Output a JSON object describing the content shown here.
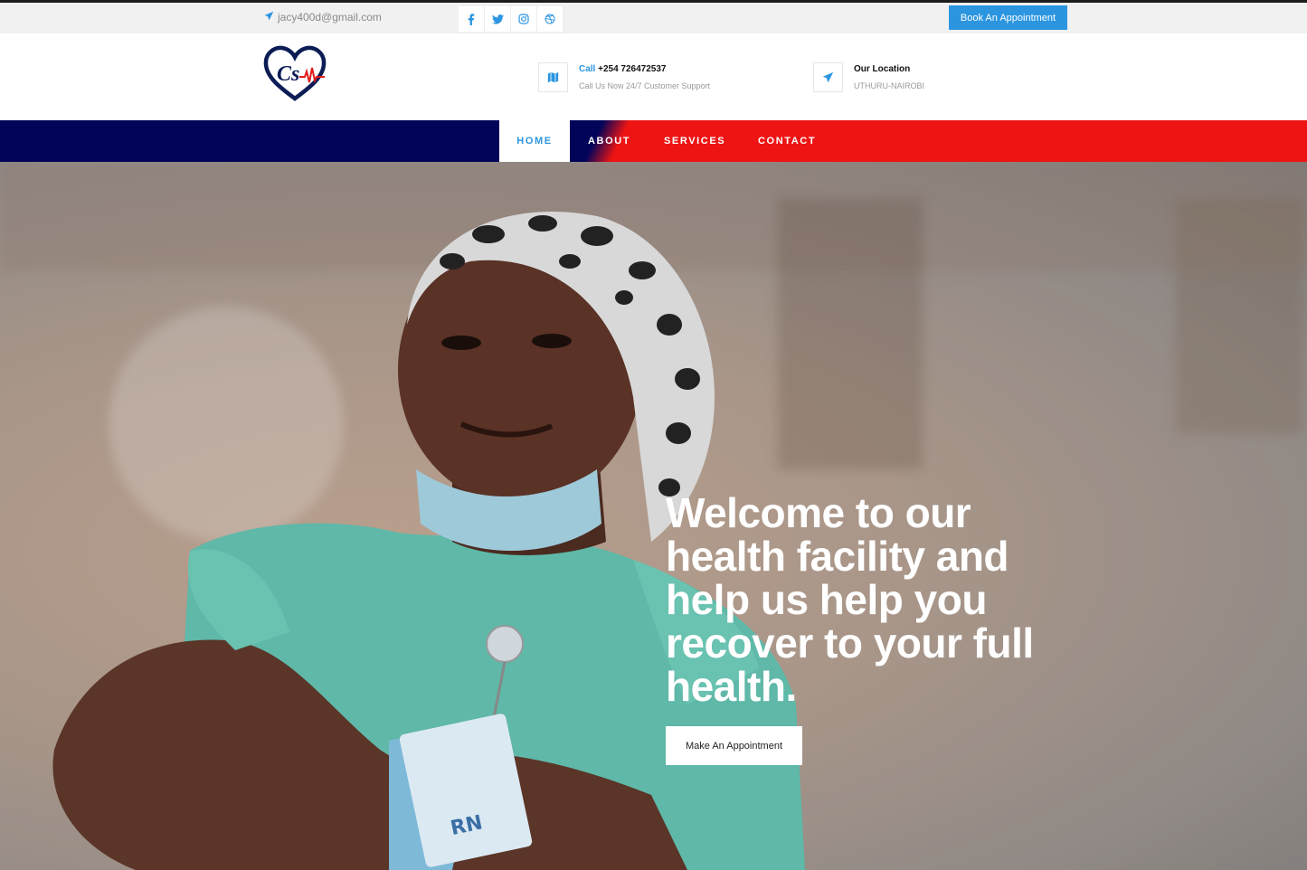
{
  "topbar": {
    "email": "jacy400d@gmail.com",
    "social_icons": [
      "facebook-icon",
      "twitter-icon",
      "instagram-icon",
      "dribbble-icon"
    ],
    "book_label": "Book An Appointment"
  },
  "header": {
    "logo_text": "Cs",
    "call": {
      "label": "Call",
      "phone": "+254 726472537",
      "sub": "Call Us Now 24/7 Customer Support"
    },
    "location": {
      "label": "Our Location",
      "sub": "UTHURU-NAIROBI"
    }
  },
  "nav": {
    "items": [
      {
        "label": "HOME",
        "active": true
      },
      {
        "label": "ABOUT",
        "active": false
      },
      {
        "label": "SERVICES",
        "active": false
      },
      {
        "label": "CONTACT",
        "active": false
      }
    ]
  },
  "hero": {
    "headline": "Welcome to our health facility and help us help you recover to your full health.",
    "button_label": "Make An Appointment"
  },
  "colors": {
    "accent": "#2b95e0",
    "navy": "#02045a",
    "red": "#ee1414"
  }
}
